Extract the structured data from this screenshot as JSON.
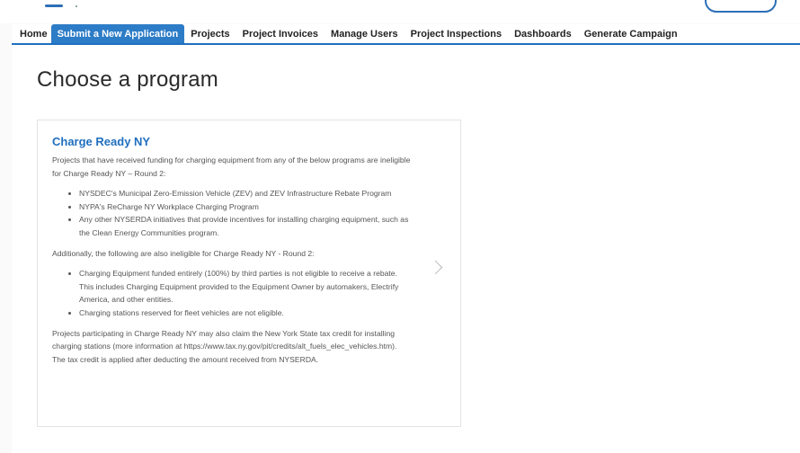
{
  "nav": {
    "items": [
      {
        "label": "Home",
        "active": false
      },
      {
        "label": "Submit a New Application",
        "active": true
      },
      {
        "label": "Projects",
        "active": false
      },
      {
        "label": "Project Invoices",
        "active": false
      },
      {
        "label": "Manage Users",
        "active": false
      },
      {
        "label": "Project Inspections",
        "active": false
      },
      {
        "label": "Dashboards",
        "active": false
      },
      {
        "label": "Generate Campaign",
        "active": false
      }
    ]
  },
  "page": {
    "title": "Choose a program"
  },
  "card": {
    "title": "Charge Ready NY",
    "intro": "Projects that have received funding for charging equipment from any of the below programs are ineligible for Charge Ready NY – Round 2:",
    "list1": [
      "NYSDEC's Municipal Zero-Emission Vehicle (ZEV) and ZEV Infrastructure Rebate Program",
      "NYPA's ReCharge NY Workplace Charging Program",
      "Any other NYSERDA initiatives that provide incentives for installing charging equipment, such as the Clean Energy Communities program."
    ],
    "additional": "Additionally, the following are also ineligible for Charge Ready NY - Round 2:",
    "list2": [
      "Charging Equipment funded entirely (100%) by third parties is not eligible to receive a rebate. This includes Charging Equipment provided to the Equipment Owner by automakers, Electrify America, and other entities.",
      "Charging stations reserved for fleet vehicles are not eligible."
    ],
    "footer": "Projects participating in Charge Ready NY may also claim the New York State tax credit for installing charging stations (more information at https://www.tax.ny.gov/pit/credits/alt_fuels_elec_vehicles.htm). The tax credit is applied after deducting the amount received from NYSERDA.",
    "chevron_icon": "chevron-right-icon"
  },
  "colors": {
    "accent": "#1f6fbf",
    "active_tab": "#2d7cc7"
  }
}
